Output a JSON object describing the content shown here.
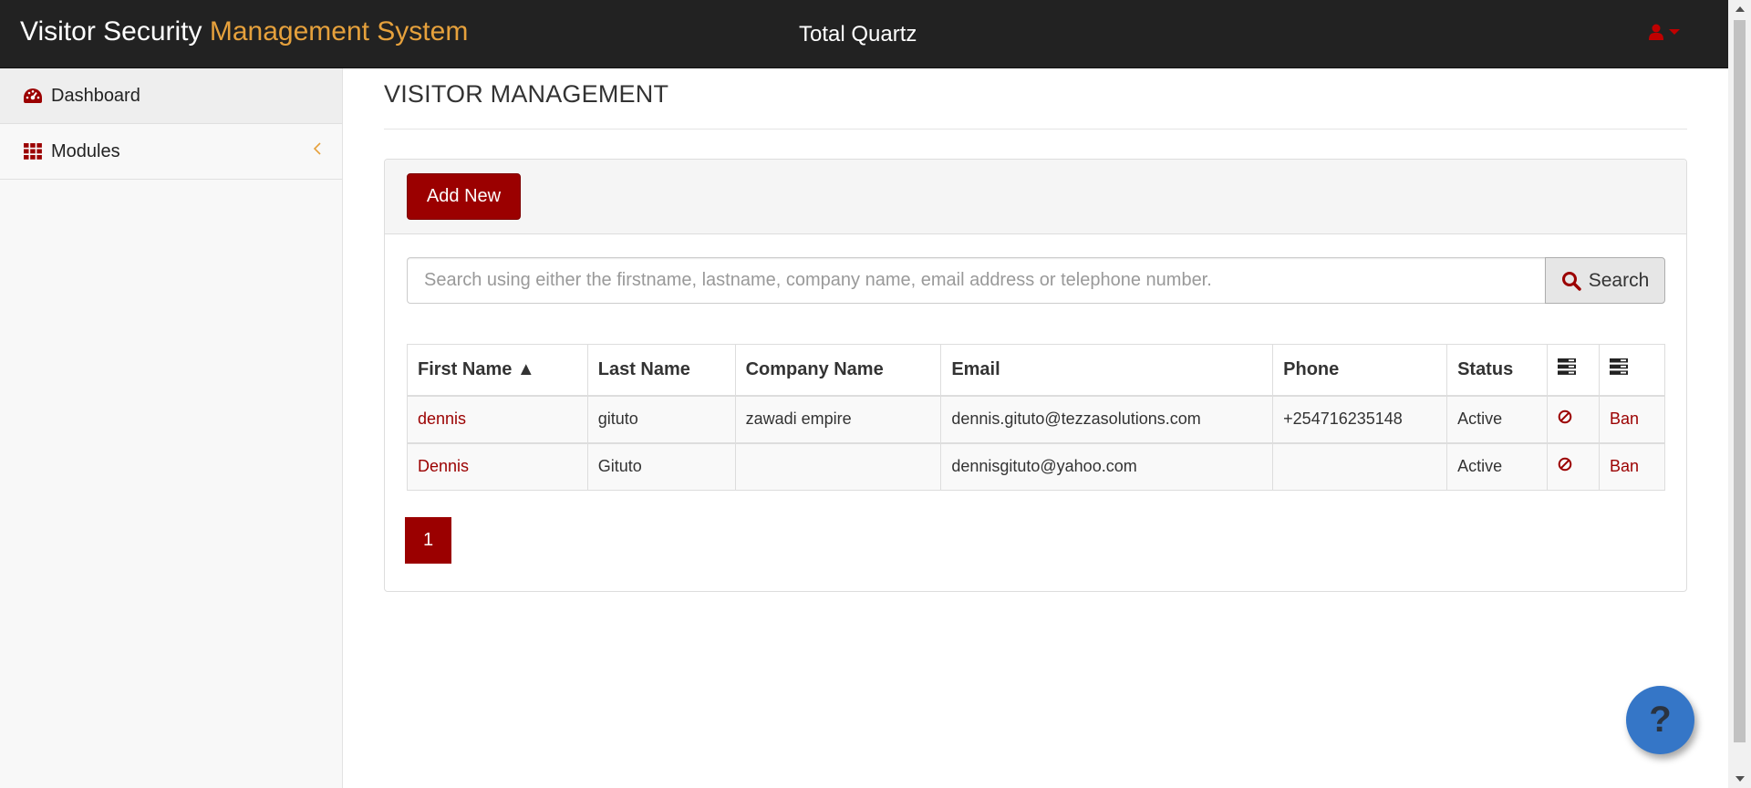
{
  "app": {
    "title_main": "Visitor Security ",
    "title_accent": "Management System",
    "organization": "Total Quartz"
  },
  "user_menu": {
    "icon": "user-icon",
    "caret": "caret-down-icon"
  },
  "sidebar": {
    "items": [
      {
        "label": "Dashboard",
        "icon": "dashboard-icon",
        "active": true
      },
      {
        "label": "Modules",
        "icon": "grid-icon",
        "chevron": "chevron-left-icon"
      }
    ]
  },
  "page": {
    "title": "VISITOR MANAGEMENT",
    "add_new_label": "Add New",
    "search": {
      "placeholder": "Search using either the firstname, lastname, company name, email address or telephone number.",
      "button_label": "Search"
    }
  },
  "table": {
    "headers": {
      "first_name": "First Name ▲",
      "last_name": "Last Name",
      "company": "Company Name",
      "email": "Email",
      "phone": "Phone",
      "status": "Status"
    },
    "rows": [
      {
        "first_name": "dennis",
        "last_name": "gituto",
        "company": "zawadi empire",
        "email": "dennis.gituto@tezzasolutions.com",
        "phone": "+254716235148",
        "status": "Active",
        "action": "Ban"
      },
      {
        "first_name": "Dennis",
        "last_name": "Gituto",
        "company": "",
        "email": "dennisgituto@yahoo.com",
        "phone": "",
        "status": "Active",
        "action": "Ban"
      }
    ]
  },
  "pagination": {
    "current": "1"
  },
  "help": {
    "label": "?"
  },
  "colors": {
    "navbar": "#222222",
    "accent_title": "#e6a13c",
    "brand_red": "#9b0000",
    "help_blue": "#3576c7"
  }
}
